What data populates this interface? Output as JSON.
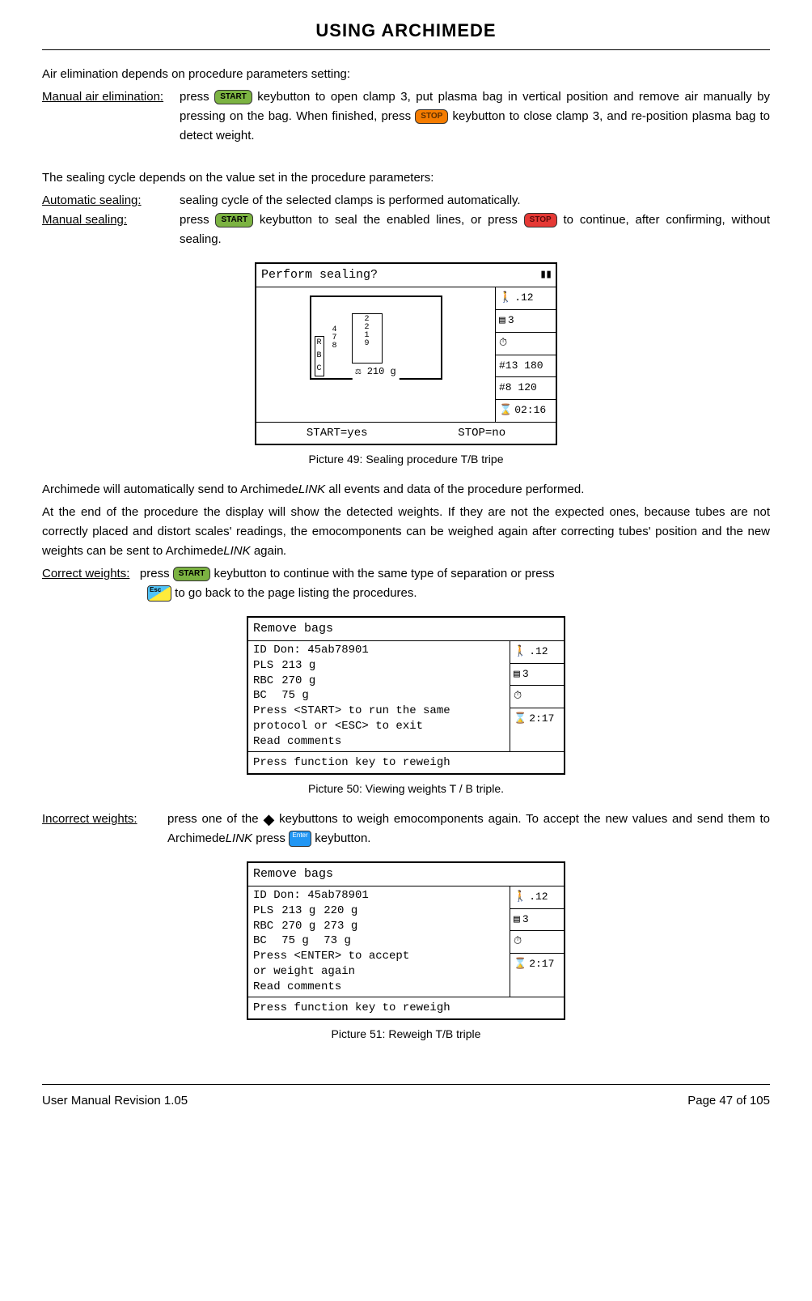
{
  "page": {
    "title": "USING ARCHIMEDE",
    "footer_left": "User Manual Revision 1.05",
    "footer_right": "Page 47 of 105"
  },
  "buttons": {
    "start": "START",
    "stop": "STOP",
    "esc": "Esc",
    "enter": "Enter"
  },
  "text": {
    "intro": "Air elimination depends on procedure parameters setting:",
    "manual_air_label": "Manual air elimination:",
    "manual_air_1a": "press ",
    "manual_air_1b": " keybutton to open clamp 3, put plasma bag in vertical position and remove air manually by pressing on the bag. When finished, press ",
    "manual_air_1c": " keybutton to close clamp 3, and re-position plasma bag to detect weight.",
    "sealing_intro": "The sealing cycle depends on the value set in the procedure parameters:",
    "auto_seal_label": "Automatic sealing:",
    "auto_seal_text": "sealing cycle of the selected clamps is performed automatically.",
    "manual_seal_label": "Manual sealing:",
    "manual_seal_1a": "press ",
    "manual_seal_1b": " keybutton to seal the enabled lines, or press ",
    "manual_seal_1c": " to continue, after confirming, without sealing.",
    "caption49": "Picture 49: Sealing procedure T/B tripe",
    "para_link_1a": "Archimede will automatically send to Archimede",
    "para_link_1b": "LINK",
    "para_link_1c": " all events and data of the procedure performed.",
    "para_link_2a": "At the end of the procedure the display will show the detected weights. If they are not the expected ones, because tubes are not correctly placed and distort scales' readings, the emocomponents can be weighed again after correcting tubes' position and the new weights can be sent to Archimede",
    "para_link_2b": "LINK",
    "para_link_2c": " again",
    "para_link_2d": ".",
    "correct_label": "Correct weights:",
    "correct_1a": "press ",
    "correct_1b": " keybutton to continue with the same type of separation or press ",
    "correct_1c": " to go back to the page listing the procedures.",
    "caption50": "Picture 50: Viewing weights T / B triple.",
    "incorrect_label": "Incorrect weights:",
    "incorrect_1a": "press one of the ",
    "incorrect_1b": " keybuttons to weigh emocomponents again. To accept the new values and send them to Archimede",
    "incorrect_1c": "LINK",
    "incorrect_1d": " press ",
    "incorrect_1e": " keybutton.",
    "caption51": "Picture 51: Reweigh T/B triple"
  },
  "lcd49": {
    "title": "Perform sealing?",
    "footer_left": "START=yes",
    "footer_right": "STOP=no",
    "weight": "210 g",
    "slot_nums": "2\n2\n1\n9",
    "slot_side": "4\n7\n8",
    "rbc_label": "R\nB\nC",
    "side": {
      "r1": ".12",
      "r2": "3",
      "r3": " ",
      "r4": "#13 180",
      "r5": "#8 120",
      "r6": "02:16"
    }
  },
  "lcd50": {
    "title": "Remove bags",
    "id_line": "ID Don: 45ab78901",
    "pls": "PLS",
    "pls_v": "213 g",
    "rbc": "RBC",
    "rbc_v": "270 g",
    "bc": "BC",
    "bc_v": "75 g",
    "msg1": "Press <START> to run the same",
    "msg2": "protocol or <ESC> to exit",
    "msg3": "Read comments",
    "footer": "Press function key to reweigh",
    "side": {
      "r1": ".12",
      "r2": "3",
      "r3": " ",
      "r4": "2:17"
    }
  },
  "lcd51": {
    "title": "Remove bags",
    "id_line": "ID Don: 45ab78901",
    "pls": "PLS",
    "pls_v1": "213 g",
    "pls_v2": "220 g",
    "rbc": "RBC",
    "rbc_v1": "270 g",
    "rbc_v2": "273 g",
    "bc": "BC",
    "bc_v1": "75 g",
    "bc_v2": "73 g",
    "msg1": "Press <ENTER> to accept",
    "msg2": "or weight again",
    "msg3": "Read comments",
    "footer": "Press function key to reweigh",
    "side": {
      "r1": ".12",
      "r2": "3",
      "r3": " ",
      "r4": "2:17"
    }
  }
}
